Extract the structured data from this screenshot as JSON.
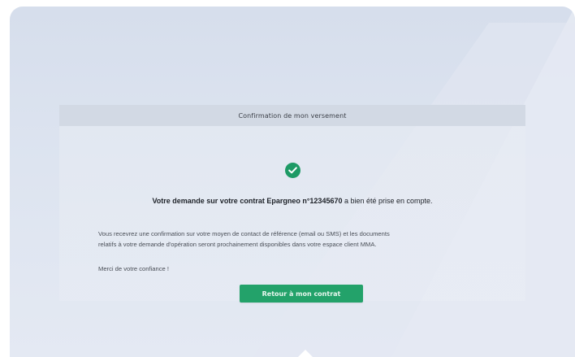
{
  "card": {
    "header_title": "Confirmation de mon versement",
    "confirmation_bold": "Votre demande sur votre contrat Epargneo n°12345670",
    "confirmation_rest": " a bien été prise en compte.",
    "info_line_1": "Vous recevrez une confirmation sur votre moyen de contact de référence (email ou SMS) et les documents",
    "info_line_2": "relatifs à votre demande d'opération seront prochainement disponibles dans votre espace client MMA.",
    "thanks": "Merci de votre confiance !",
    "return_button_label": "Retour à mon contrat"
  },
  "icons": {
    "status": "check-circle-icon"
  },
  "colors": {
    "accent_green": "#23a26a",
    "check_green": "#1e9a66",
    "background_blue": "#d6deec",
    "header_band": "#d2d9e4"
  }
}
